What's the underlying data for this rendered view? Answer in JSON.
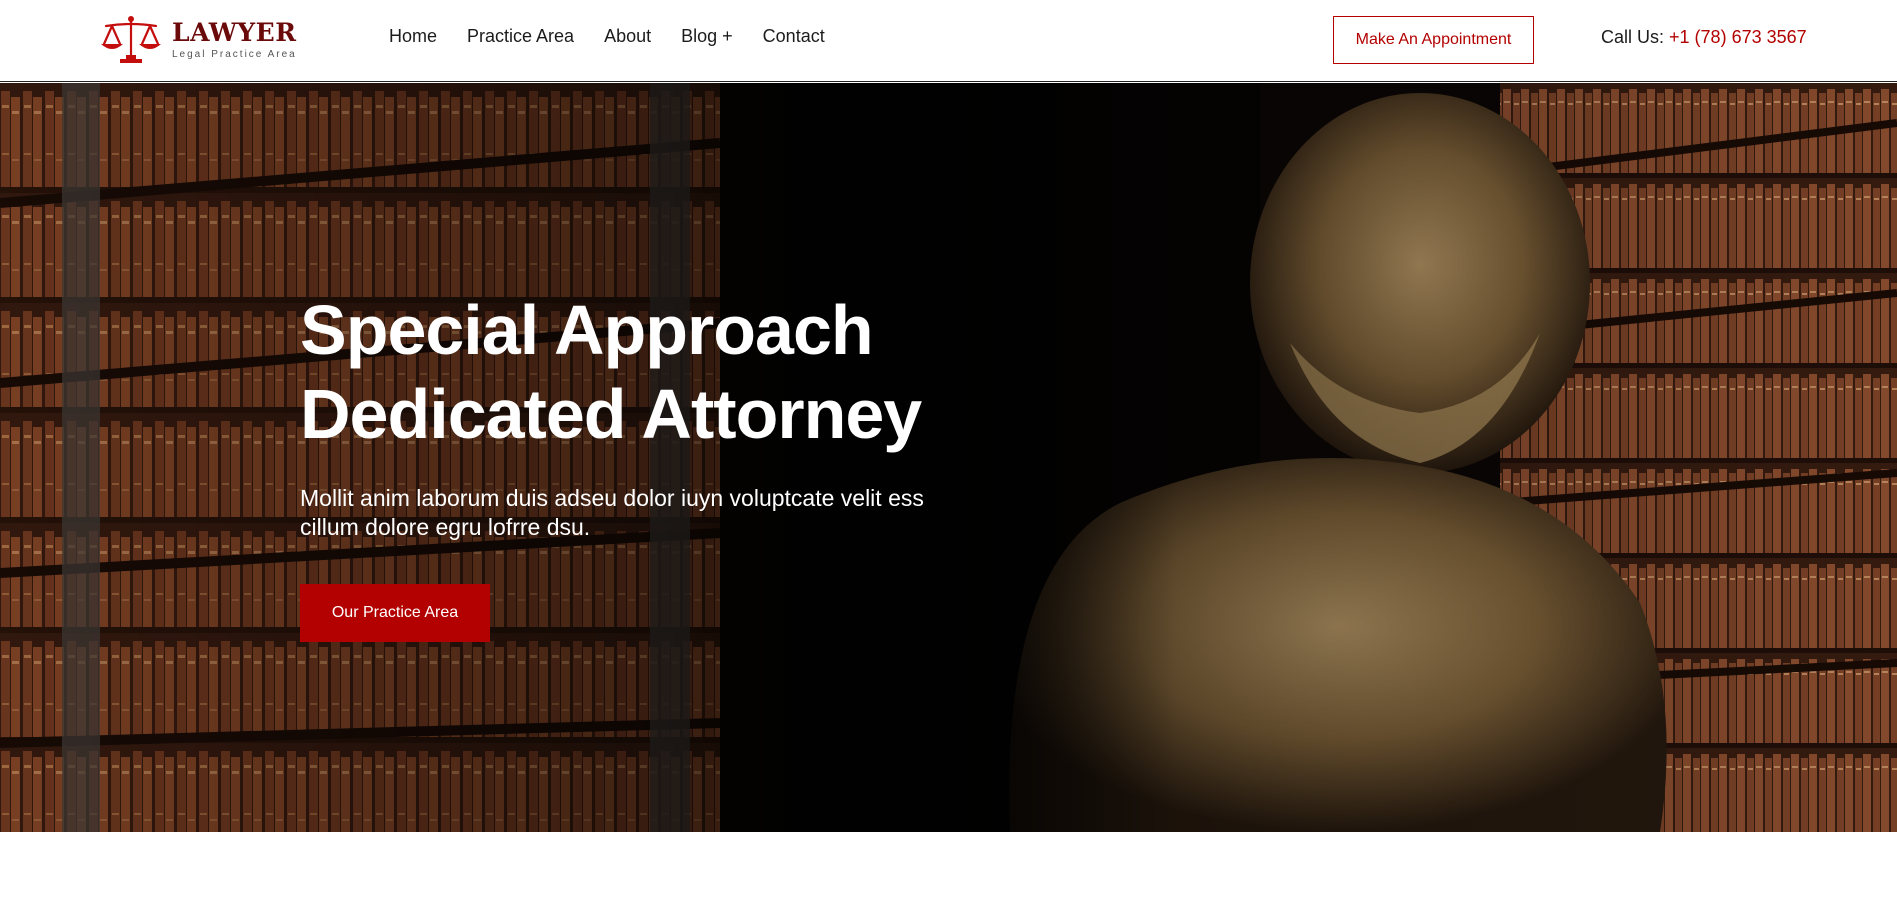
{
  "brand": {
    "name": "LAWYER",
    "tagline": "Legal Practice Area",
    "logo_icon": "scales-of-justice-icon",
    "accent_color": "#b30000",
    "dark_brand_color": "#6a0a0a"
  },
  "nav": {
    "items": [
      {
        "label": "Home"
      },
      {
        "label": "Practice Area"
      },
      {
        "label": "About"
      },
      {
        "label": "Blog +"
      },
      {
        "label": "Contact"
      }
    ]
  },
  "header": {
    "appointment_button": "Make An Appointment",
    "call_label": "Call Us:",
    "call_number": "+1 (78) 673 3567"
  },
  "hero": {
    "title_line1": "Special Approach",
    "title_line2": "Dedicated Attorney",
    "text": "Mollit anim laborum duis adseu dolor iuyn voluptcate velit ess cillum dolore egru lofrre dsu.",
    "button": "Our Practice Area"
  }
}
